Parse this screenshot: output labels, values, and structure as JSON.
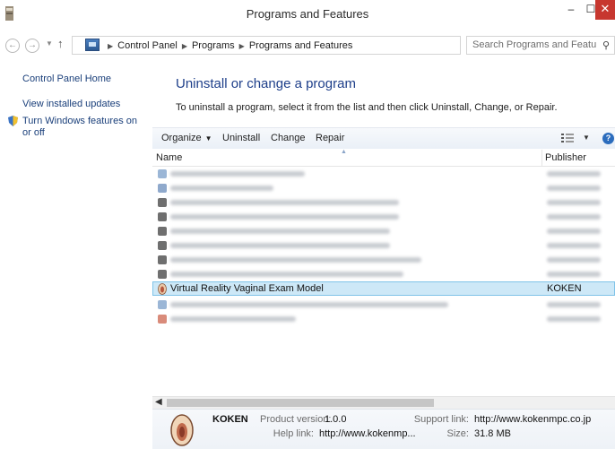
{
  "window": {
    "title": "Programs and Features",
    "minimize_label": "–",
    "maximize_label": "☐",
    "close_label": "✕"
  },
  "address_bar": {
    "breadcrumbs": [
      "Control Panel",
      "Programs",
      "Programs and Features"
    ],
    "search_placeholder": "Search Programs and Features"
  },
  "left_nav": {
    "home": "Control Panel Home",
    "updates": "View installed updates",
    "features": "Turn Windows features on or off"
  },
  "main": {
    "heading": "Uninstall or change a program",
    "instructions": "To uninstall a program, select it from the list and then click Uninstall, Change, or Repair."
  },
  "toolbar": {
    "organize": "Organize",
    "uninstall": "Uninstall",
    "change": "Change",
    "repair": "Repair"
  },
  "list": {
    "columns": [
      "Name",
      "Publisher"
    ],
    "selected_program": {
      "name": "Virtual Reality Vaginal Exam Model",
      "publisher": "KOKEN"
    }
  },
  "details": {
    "publisher": "KOKEN",
    "product_version_label": "Product version:",
    "product_version": "1.0.0",
    "help_link_label": "Help link:",
    "help_link": "http://www.kokenmp...",
    "support_link_label": "Support link:",
    "support_link": "http://www.kokenmpc.co.jp",
    "size_label": "Size:",
    "size": "31.8 MB"
  },
  "colors": {
    "accent": "#1e3f8a",
    "selection": "#cde8f7",
    "close": "#c7372f"
  }
}
